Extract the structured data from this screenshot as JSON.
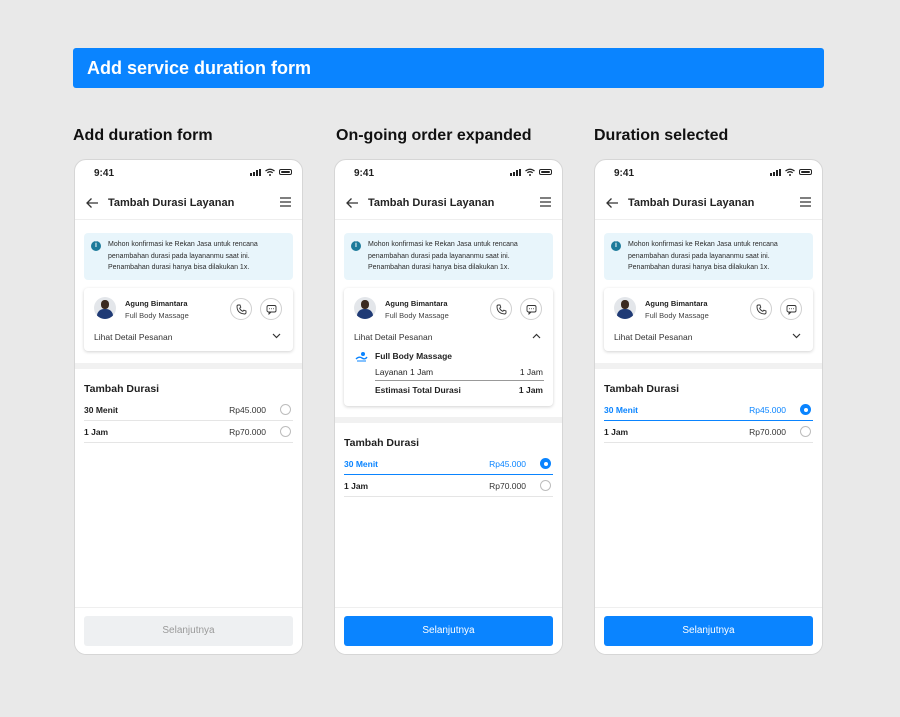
{
  "banner": {
    "title": "Add service duration form"
  },
  "columns": [
    {
      "title": "Add duration form"
    },
    {
      "title": "On-going order expanded"
    },
    {
      "title": "Duration selected"
    }
  ],
  "phone": {
    "time": "9:41",
    "title": "Tambah Durasi Layanan",
    "info_text": "Mohon konfirmasi ke Rekan Jasa untuk rencana penambahan durasi pada layananmu saat ini. Penambahan durasi hanya bisa dilakukan 1x.",
    "partner_name": "Agung Bimantara",
    "partner_service": "Full Body Massage",
    "detail_label": "Lihat Detail Pesanan",
    "section_title": "Tambah Durasi",
    "options": [
      {
        "label": "30 Menit",
        "price": "Rp45.000"
      },
      {
        "label": "1 Jam",
        "price": "Rp70.000"
      }
    ],
    "cta": "Selanjutnya"
  },
  "expanded": {
    "service_name": "Full Body Massage",
    "service_line": "Layanan 1 Jam",
    "service_value": "1 Jam",
    "total_label": "Estimasi Total Durasi",
    "total_value": "1 Jam"
  },
  "colors": {
    "accent": "#0a84ff",
    "info_bg": "#e8f5fb",
    "disabled_bg": "#eef0f2"
  }
}
